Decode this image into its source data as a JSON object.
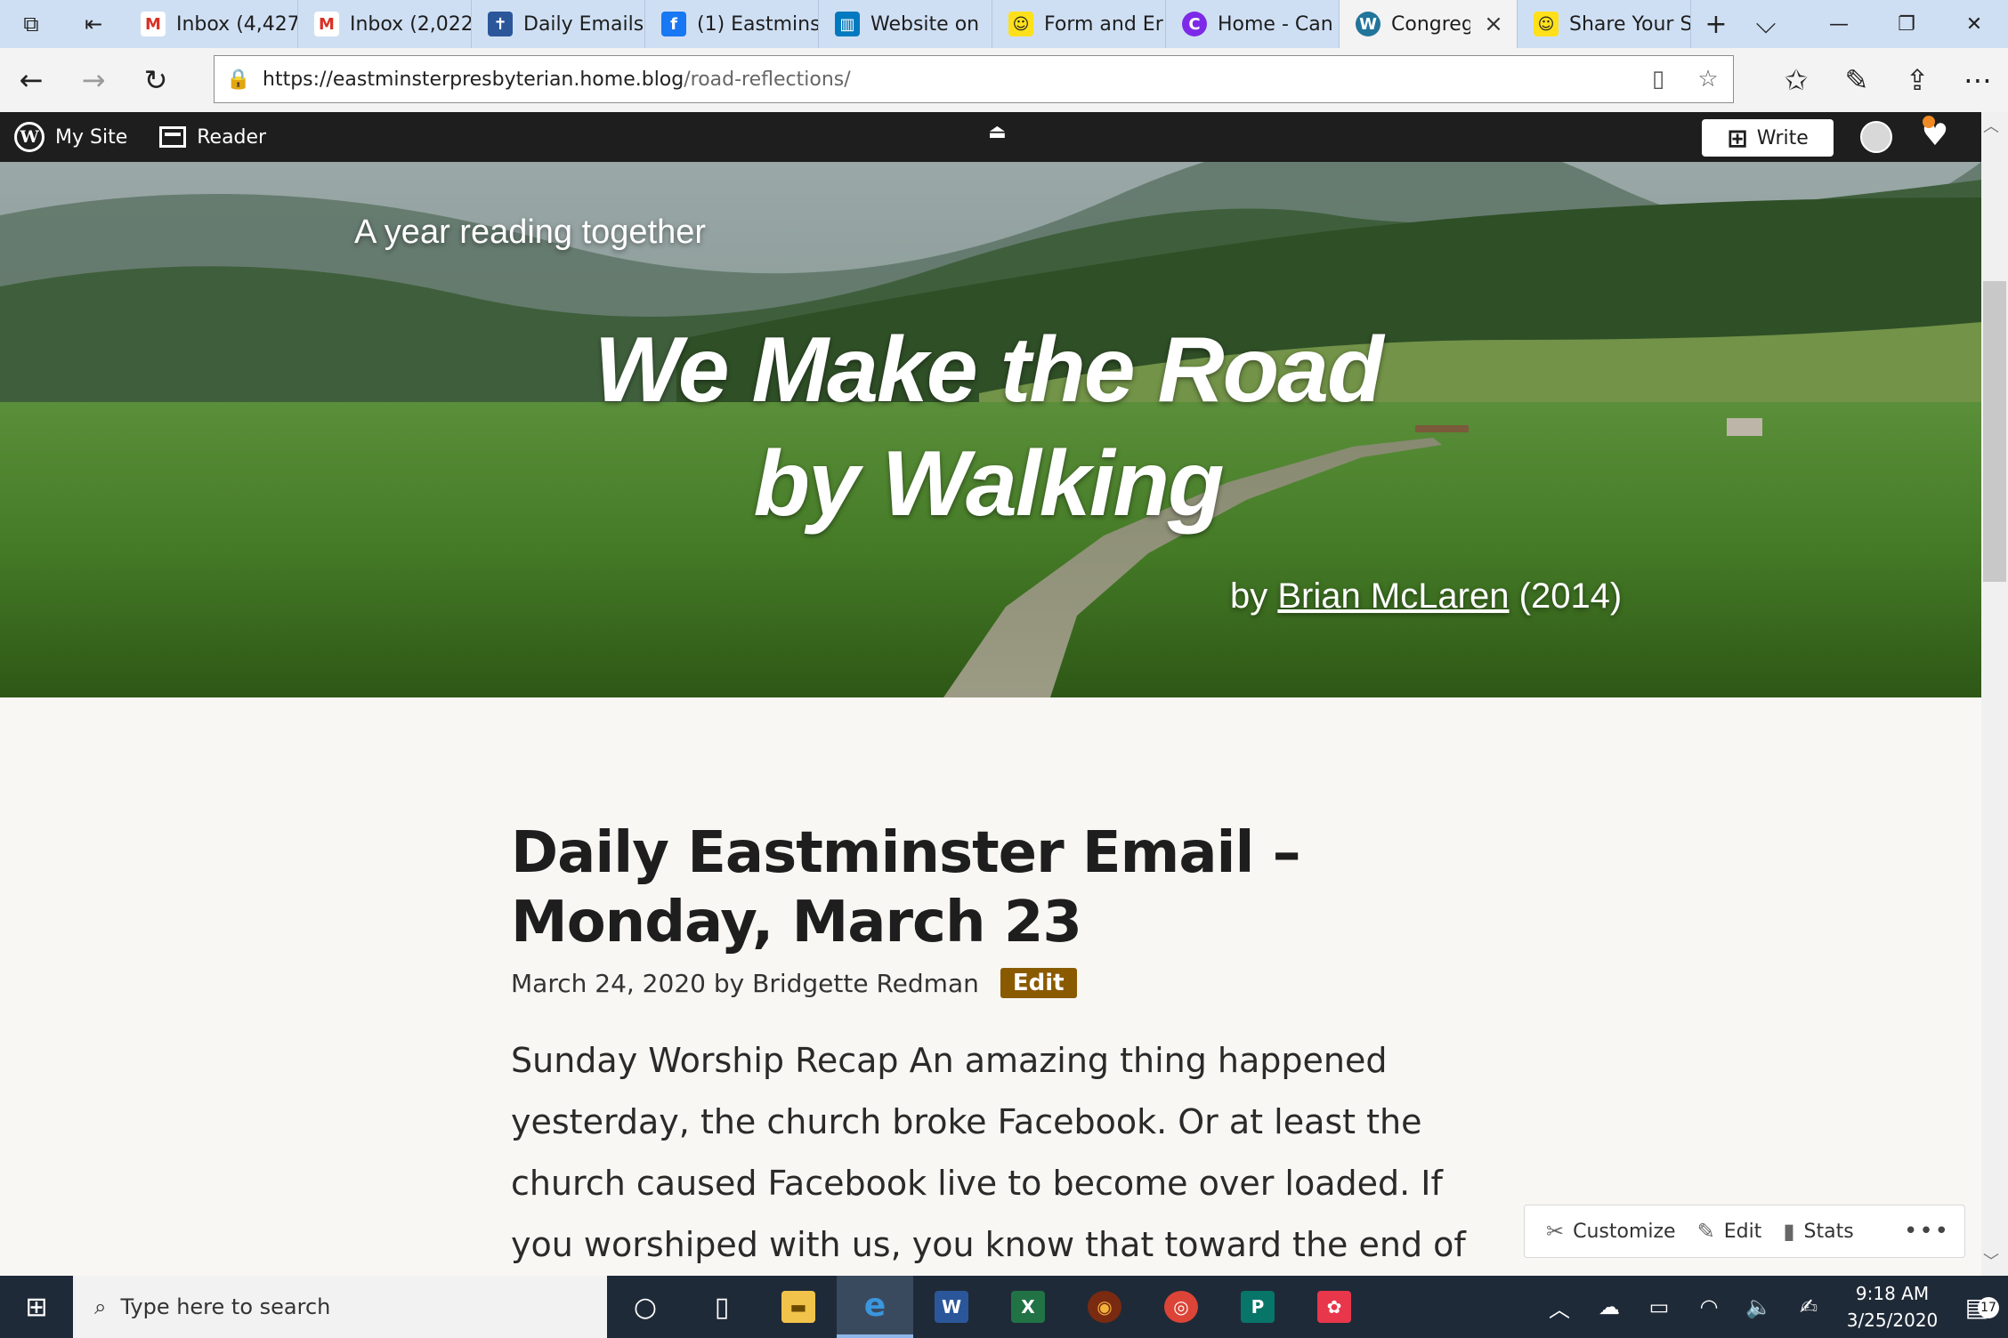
{
  "tabstrip": {
    "tabs": [
      {
        "label": "Inbox (4,427",
        "icon": "gmail-icon",
        "color": "#d93025"
      },
      {
        "label": "Inbox (2,022",
        "icon": "gmail-icon",
        "color": "#d93025"
      },
      {
        "label": "Daily Emails",
        "icon": "site-icon",
        "color": "#2b579a"
      },
      {
        "label": "(1) Eastmins",
        "icon": "facebook-icon",
        "color": "#1877f2"
      },
      {
        "label": "Website on",
        "icon": "trello-icon",
        "color": "#0079bf"
      },
      {
        "label": "Form and Er",
        "icon": "mailchimp-icon",
        "color": "#ffe01b"
      },
      {
        "label": "Home - Can",
        "icon": "canva-icon",
        "color": "#7d2ae8"
      },
      {
        "label": "Congreg",
        "icon": "wordpress-icon",
        "color": "#21759b"
      },
      {
        "label": "Share Your S",
        "icon": "mailchimp-icon",
        "color": "#ffe01b"
      }
    ],
    "new_tab": "+",
    "tab_list": "⌵"
  },
  "address": {
    "domain": "https://eastminsterpresbyterian.home.blog",
    "path": "/road-reflections/"
  },
  "wpbar": {
    "my_site": "My Site",
    "reader": "Reader",
    "write": "Write"
  },
  "hero": {
    "tagline": "A year reading together",
    "title_line1": "We Make the Road",
    "title_line2": "by Walking",
    "byline_prefix": "by",
    "author": "Brian McLaren",
    "year": "(2014)"
  },
  "post": {
    "title": "Daily Eastminster Email – Monday, March 23",
    "date": "March 24, 2020",
    "by": "by",
    "author": "Bridgette Redman",
    "edit": "Edit",
    "body": "Sunday Worship Recap An amazing thing happened yesterday, the church broke Facebook.  Or at least the church caused Facebook live to become over loaded.  If you worshiped with us, you know that toward the end of"
  },
  "customize_panel": {
    "customize": "Customize",
    "edit": "Edit",
    "stats": "Stats",
    "more": "•••"
  },
  "taskbar": {
    "search_placeholder": "Type here to search",
    "time": "9:18 AM",
    "date": "3/25/2020",
    "notification_count": "17"
  },
  "colors": {
    "wp_bar": "#1e1e1e",
    "edit_badge": "#8a5a00",
    "page_bg": "#f8f7f3",
    "taskbar": "#1f2a38"
  }
}
